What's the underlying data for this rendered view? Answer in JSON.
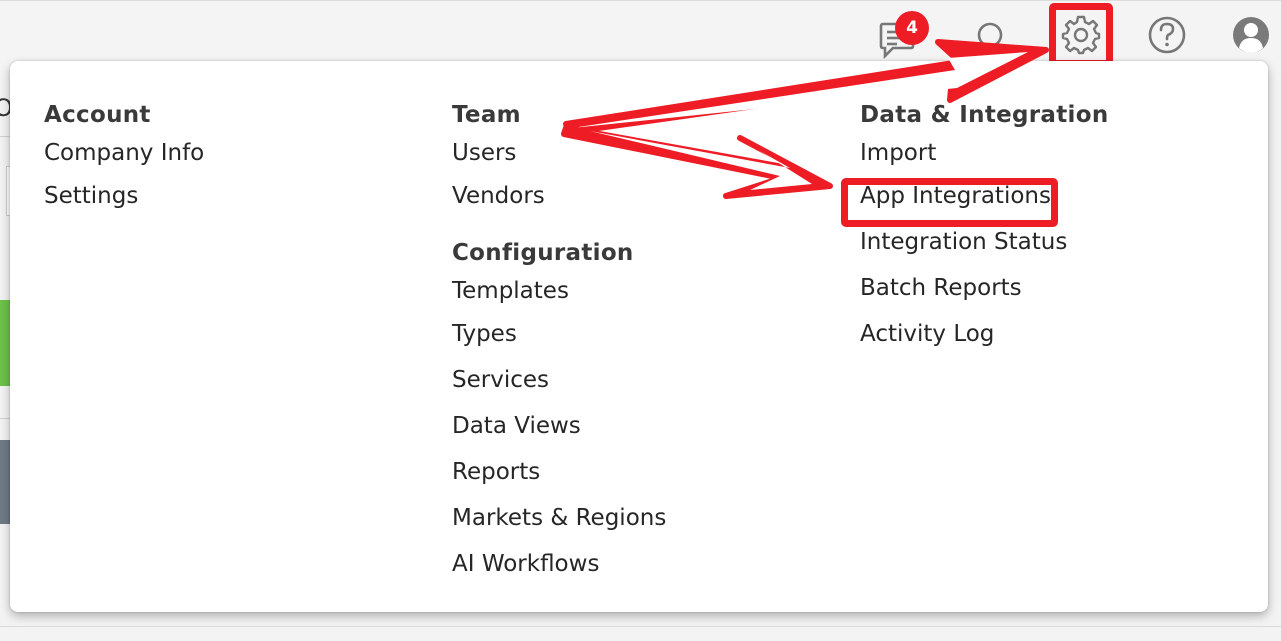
{
  "header": {
    "notification_count": "4",
    "icons": [
      "chat-icon",
      "search-icon",
      "gear-icon",
      "help-icon",
      "user-avatar-icon"
    ]
  },
  "menu": {
    "account": {
      "heading": "Account",
      "items": [
        "Company Info",
        "Settings"
      ]
    },
    "team": {
      "heading": "Team",
      "items": [
        "Users",
        "Vendors"
      ]
    },
    "configuration": {
      "heading": "Configuration",
      "items": [
        "Templates",
        "Types",
        "Services",
        "Data Views",
        "Reports",
        "Markets & Regions",
        "AI Workflows"
      ]
    },
    "data_integration": {
      "heading": "Data & Integration",
      "items": [
        "Import",
        "App Integrations",
        "Integration Status",
        "Batch Reports",
        "Activity Log"
      ]
    }
  },
  "annotation": {
    "color": "#ee1c25",
    "highlighted": [
      "gear-icon",
      "App Integrations"
    ]
  },
  "colors": {
    "panel_background": "#ffffff",
    "page_background": "#f3f3f3",
    "accent_red": "#ee1c25"
  }
}
